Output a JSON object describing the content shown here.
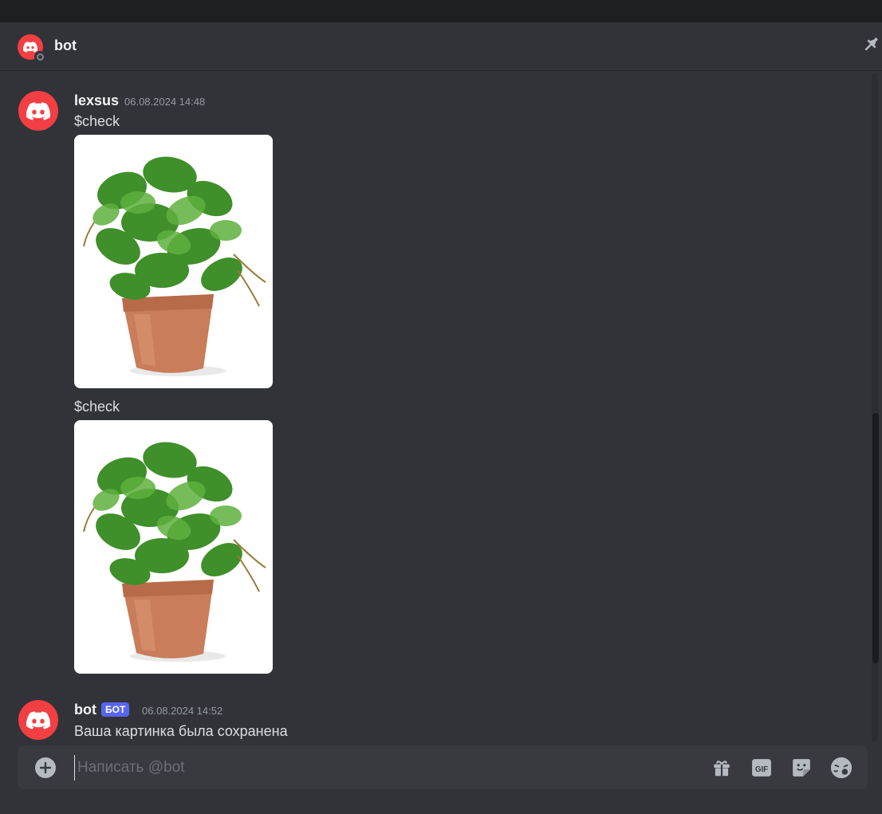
{
  "colors": {
    "background": "#313338",
    "accent_red": "#f23f43",
    "bot_tag": "#5865f2",
    "composer": "#383a40"
  },
  "header": {
    "title": "bot",
    "avatar_icon": "discord-logo-icon",
    "pin_icon": "pin-icon"
  },
  "messages": [
    {
      "author": "lexsus",
      "timestamp": "06.08.2024 14:48",
      "items": [
        {
          "text": "$check",
          "attachment": "plant-in-pot-image"
        },
        {
          "text": "$check",
          "attachment": "plant-in-pot-image"
        }
      ]
    },
    {
      "author": "bot",
      "tag": "БОТ",
      "timestamp": "06.08.2024 14:52",
      "text": "Ваша картинка была сохранена"
    }
  ],
  "composer": {
    "placeholder": "Написать @bot",
    "value": "",
    "icons": [
      "add-circle-icon",
      "gift-icon",
      "gif-icon",
      "sticker-icon",
      "emoji-icon"
    ]
  }
}
